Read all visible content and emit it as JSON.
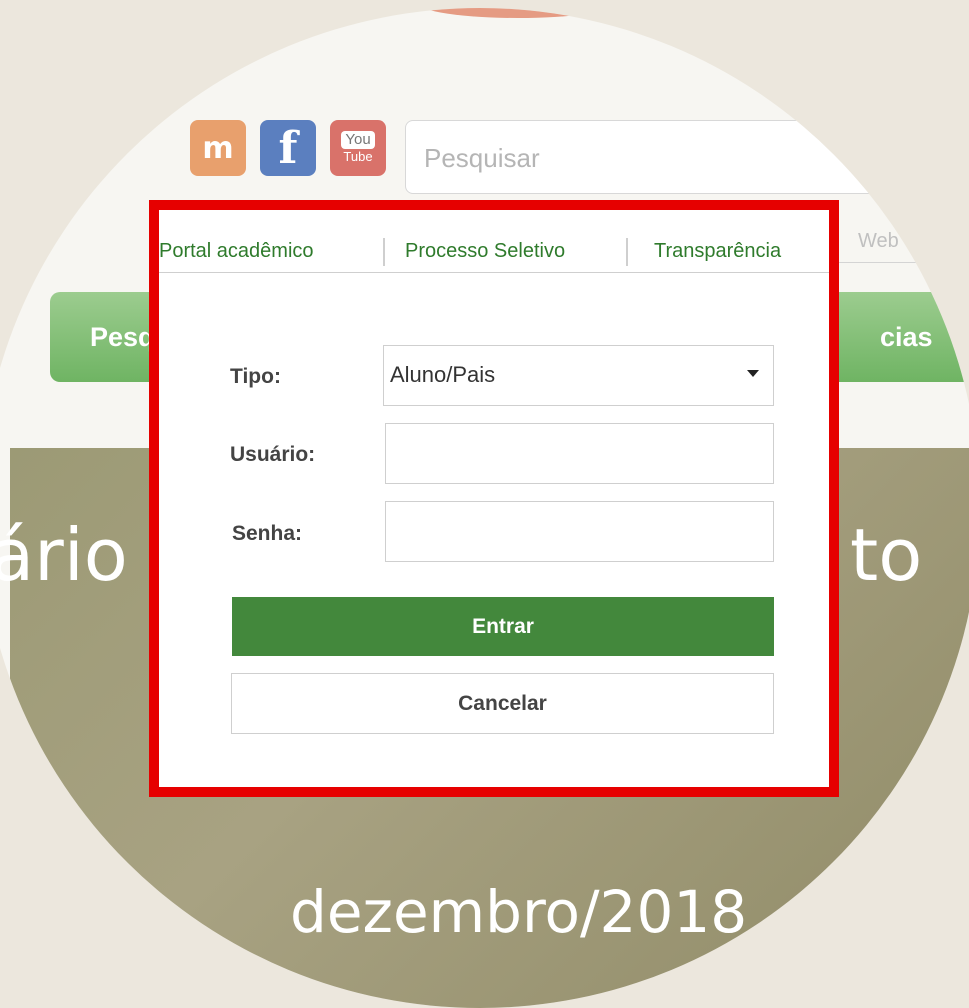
{
  "social": {
    "facebook_glyph": "f",
    "youtube_top": "You",
    "youtube_bottom": "Tube"
  },
  "search": {
    "placeholder": "Pesquisar"
  },
  "nav_links": [
    "Portal acadêmico",
    "Processo Seletivo",
    "Transparência",
    "Web"
  ],
  "green_menu": {
    "left_partial": "Pesq",
    "right_partial": "cias"
  },
  "banner": {
    "title_left": "ário",
    "title_right": "to",
    "date_text": "dezembro/2018"
  },
  "login_form": {
    "tipo_label": "Tipo:",
    "tipo_value": "Aluno/Pais",
    "usuario_label": "Usuário:",
    "usuario_value": "",
    "senha_label": "Senha:",
    "senha_value": "",
    "enter_button": "Entrar",
    "cancel_button": "Cancelar"
  },
  "colors": {
    "highlight_border": "#e60000",
    "primary_green": "#43883c",
    "link_green": "#2f7b2c"
  }
}
